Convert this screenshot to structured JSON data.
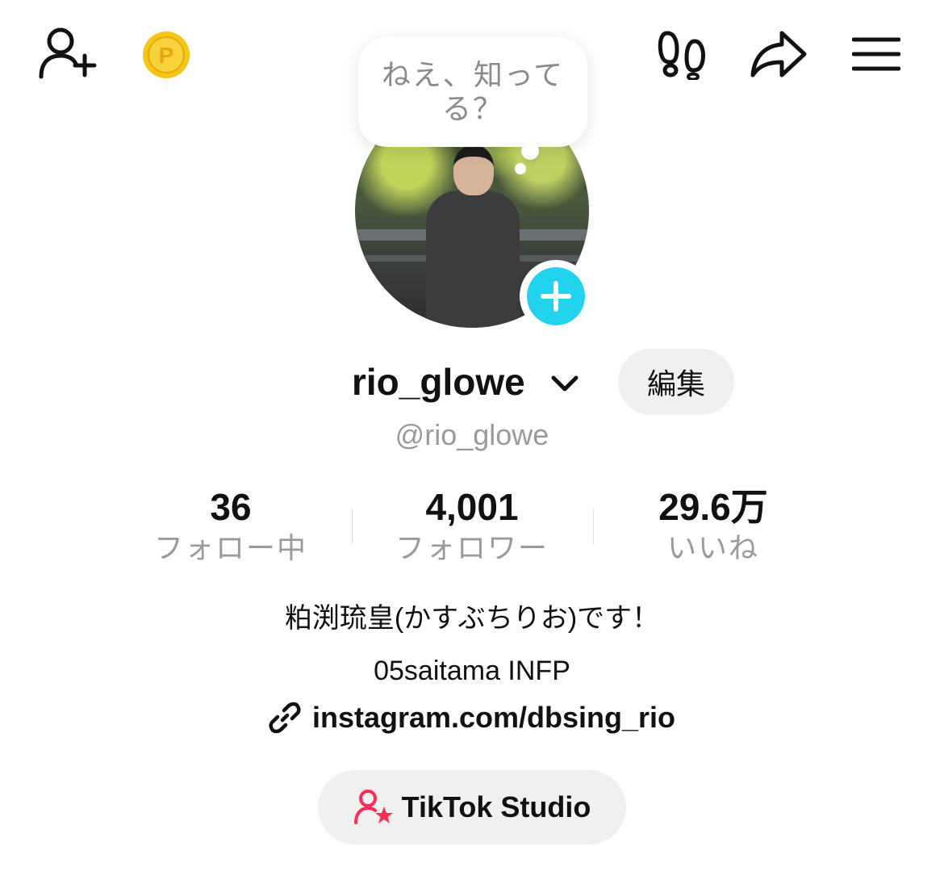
{
  "topbar": {
    "icons": [
      "add-friend-icon",
      "coin-icon",
      "footprints-icon",
      "share-icon",
      "menu-icon"
    ],
    "coin_letter": "P",
    "coin_color": "#f5c518"
  },
  "bubble": {
    "text": "ねえ、知ってる？"
  },
  "profile": {
    "username": "rio_glowe",
    "handle": "@rio_glowe",
    "edit_label": "編集",
    "add_story_color": "#22d3ee"
  },
  "stats": [
    {
      "value": "36",
      "label": "フォロー中"
    },
    {
      "value": "4,001",
      "label": "フォロワー"
    },
    {
      "value": "29.6万",
      "label": "いいね"
    }
  ],
  "bio": {
    "line1": "粕渕琉皇(かすぶちりお)です！",
    "line2": "05saitama INFP",
    "link": "instagram.com/dbsing_rio"
  },
  "studio": {
    "label": "TikTok Studio",
    "icon_color": "#fe2c55"
  }
}
